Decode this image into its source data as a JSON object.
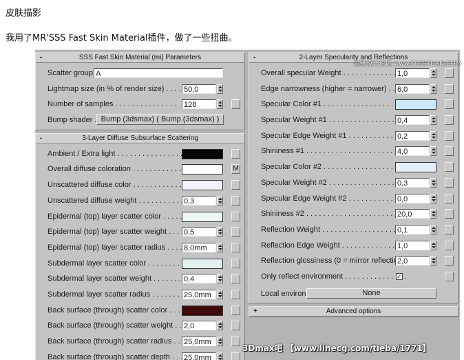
{
  "doc": {
    "title": "皮肤描影",
    "text": "我用了MR'SSS Fast Skin Material插件，做了一些扭曲。"
  },
  "watermarks": {
    "top": "思缘设计论坛 www.MISSYUAN.COM",
    "bottom": "3Dmax吧 【www.linecg.com/tieba/1771】"
  },
  "left": {
    "params": {
      "toggle": "-",
      "title": "SSS Fast Skin Material (mi) Parameters",
      "scatter_group_label": "Scatter group...",
      "scatter_group_value": "A",
      "lightmap_label": "Lightmap size (in % of render size) . . . . . . . .",
      "lightmap_value": "50,0",
      "samples_label": "Number of samples . . . . . . . . . . . . . . .",
      "samples_value": "128",
      "bump_label": "Bump shader . .",
      "bump_button": "Bump (3dsmax)  ( Bump (3dsmax) )"
    },
    "diffuse": {
      "toggle": "-",
      "title": "3-Layer Diffuse Subsurface Scattering",
      "rows": [
        {
          "label": "Ambient / Extra light . . . . . . . . . . . . . . . . .",
          "kind": "swatch",
          "color": "#050505",
          "map": ""
        },
        {
          "label": "Overall diffuse coloration . . . . . . . . . . . . . .",
          "kind": "swatch",
          "color": "#ffffff",
          "map": "M"
        },
        {
          "label": "Unscattered diffuse color . . . . . . . . . . . . . .",
          "kind": "swatch",
          "color": "#f3f1fb",
          "map": ""
        },
        {
          "label": "Unscattered diffuse weight . . . . . . . . . . . . .",
          "kind": "value",
          "value": "0,3",
          "map": ""
        },
        {
          "label": "Epidermal (top) layer scatter color . . . . . . . .",
          "kind": "swatch",
          "color": "#eef6f6",
          "map": ""
        },
        {
          "label": "Epidermal (top) layer scatter weight . . . . . . .",
          "kind": "value",
          "value": "0,5",
          "map": ""
        },
        {
          "label": "Epidermal (top) layer scatter radius . . . . . . .",
          "kind": "value",
          "value": "8,0mm",
          "map": ""
        },
        {
          "label": "Subdermal layer scatter color . . . . . . . . . . .",
          "kind": "swatch",
          "color": "#e2f0f0",
          "map": ""
        },
        {
          "label": "Subdermal layer scatter weight . . . . . . . . . .",
          "kind": "value",
          "value": "0,4",
          "map": ""
        },
        {
          "label": "Subdermal layer scatter radius . . . . . . . . . .",
          "kind": "value",
          "value": "25,0mm",
          "map": ""
        },
        {
          "label": "Back surface (through) scatter color . . . . . . .",
          "kind": "swatch",
          "color": "#3e0909",
          "map": ""
        },
        {
          "label": "Back surface (through) scatter weight . . . . .",
          "kind": "value",
          "value": "2,0",
          "map": ""
        },
        {
          "label": "Back surface (through) scatter radius . . . . .",
          "kind": "value",
          "value": "25,0mm",
          "map": ""
        },
        {
          "label": "Back surface (through) scatter depth . . . . .",
          "kind": "value",
          "value": "25,0mm",
          "map": ""
        }
      ]
    }
  },
  "right": {
    "spec": {
      "toggle": "-",
      "title": "2-Layer Specularity and Reflections",
      "rows": [
        {
          "label": "Overall specular Weight . . . . . . . . . . . . . . .",
          "kind": "value",
          "value": "1,0"
        },
        {
          "label": "Edge narrowness (higher = narrower) . . . . . .",
          "kind": "value",
          "value": "6,0"
        },
        {
          "label": "Specular Color #1 . . . . . . . . . . . . . . . . . . . . .",
          "kind": "swatch",
          "color": "#cde9f8"
        },
        {
          "label": "Specular Weight #1 . . . . . . . . . . . . . . . . . . .",
          "kind": "value",
          "value": "0,4"
        },
        {
          "label": "Specular Edge Weight #1 . . . . . . . . . . . . . .",
          "kind": "value",
          "value": "0,2"
        },
        {
          "label": "Shininess #1 . . . . . . . . . . . . . . . . . . . . . . . .",
          "kind": "value",
          "value": "4,0"
        },
        {
          "label": "Specular Color #2 . . . . . . . . . . . . . . . . . . . . .",
          "kind": "swatch",
          "color": "#e2eef9"
        },
        {
          "label": "Specular Weight #2 . . . . . . . . . . . . . . . . . . .",
          "kind": "value",
          "value": "0,3"
        },
        {
          "label": "Specular Edge Weight #2 . . . . . . . . . . . . . .",
          "kind": "value",
          "value": "0,0"
        },
        {
          "label": "Shininess #2 . . . . . . . . . . . . . . . . . . . . . . . .",
          "kind": "value",
          "value": "20,0"
        },
        {
          "label": "Reflection Weight . . . . . . . . . . . . . . . . . . . . .",
          "kind": "value",
          "value": "0,1"
        },
        {
          "label": "Reflection Edge Weight . . . . . . . . . . . . . . . .",
          "kind": "value",
          "value": "1,0"
        },
        {
          "label": "Reflection glossiness (0 = mirror reflection) . .",
          "kind": "value",
          "value": "2,0"
        },
        {
          "label": "Only reflect environment . . . . . . . . . . . . . . .",
          "kind": "check",
          "value": "✓"
        }
      ],
      "local_env_label": "Local environ....",
      "local_env_button": "None"
    },
    "advanced": {
      "toggle": "+",
      "title": "Advanced options"
    }
  }
}
